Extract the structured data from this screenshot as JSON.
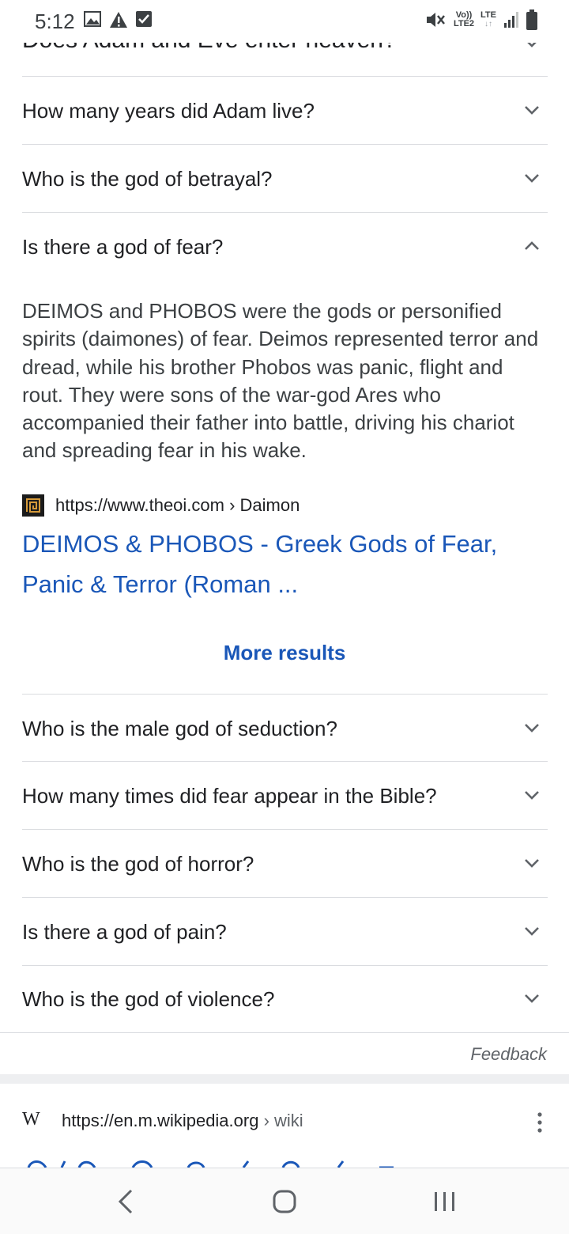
{
  "status_bar": {
    "time": "5:12",
    "left_icons": [
      "image-icon",
      "warning-icon",
      "checkbox-icon"
    ],
    "vol_label": "Vo))",
    "lte2_label": "LTE2",
    "lte_label": "LTE",
    "right_icons": [
      "mute-icon",
      "signal-icon",
      "battery-icon"
    ]
  },
  "questions_above": [
    {
      "text": "Does Adam and Eve enter heaven?",
      "expanded": false
    },
    {
      "text": "How many years did Adam live?",
      "expanded": false
    },
    {
      "text": "Who is the god of betrayal?",
      "expanded": false
    },
    {
      "text": "Is there a god of fear?",
      "expanded": true
    }
  ],
  "answer": {
    "text": "DEIMOS and PHOBOS were the gods or personified spirits (daimones) of fear. Deimos represented terror and dread, while his brother Phobos was panic, flight and rout. They were sons of the war-god Ares who accompanied their father into battle, driving his chariot and spreading fear in his wake.",
    "source_url": "https://www.theoi.com › Daimon",
    "title": "DEIMOS & PHOBOS - Greek Gods of Fear, Panic & Terror (Roman ..."
  },
  "more_results_label": "More results",
  "questions_below": [
    {
      "text": "Who is the male god of seduction?"
    },
    {
      "text": "How many times did fear appear in the Bible?"
    },
    {
      "text": "Who is the god of horror?"
    },
    {
      "text": "Is there a god of pain?"
    },
    {
      "text": "Who is the god of violence?"
    }
  ],
  "feedback_label": "Feedback",
  "wiki_result": {
    "logo": "W",
    "url_domain": "https://en.m.wikipedia.org",
    "url_crumb": " › wiki"
  },
  "colors": {
    "link": "#1a57b8",
    "divider": "#dadce0",
    "text": "#202124"
  }
}
